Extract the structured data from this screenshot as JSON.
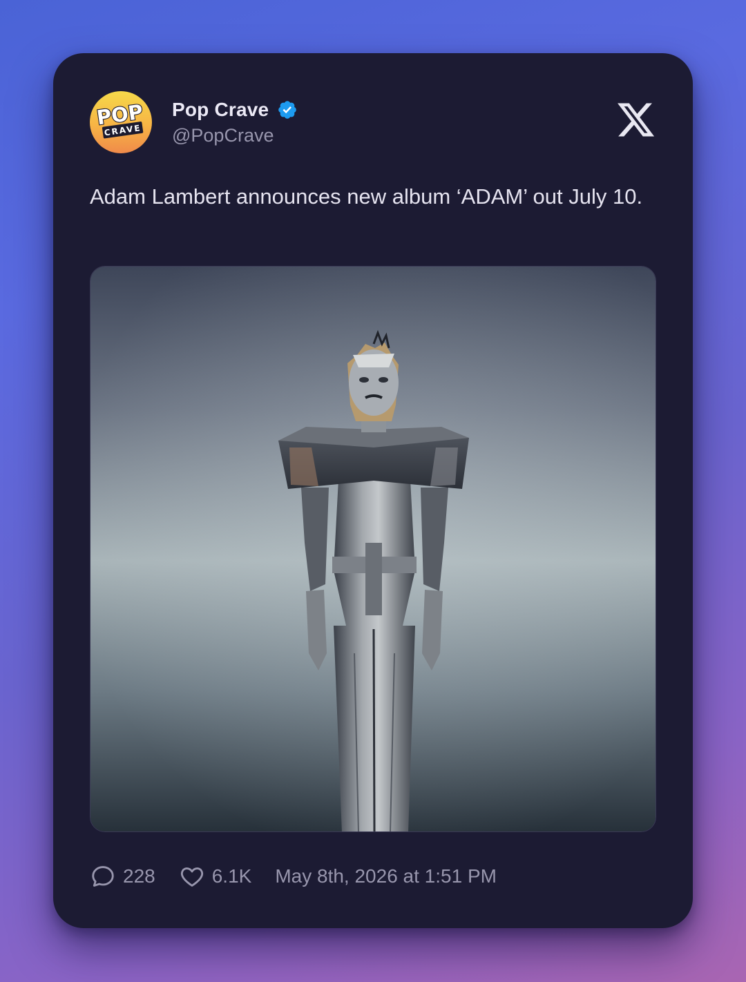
{
  "tweet": {
    "author_name": "Pop Crave",
    "author_handle": "@PopCrave",
    "verified": true,
    "avatar_text_top": "POP",
    "avatar_text_bottom": "CRAVE",
    "text": "Adam Lambert announces new album ‘ADAM’ out July 10.",
    "replies": "228",
    "likes": "6.1K",
    "timestamp": "May 8th, 2026 at 1:51 PM"
  },
  "icons": {
    "platform": "x-logo-icon",
    "reply": "speech-bubble-icon",
    "like": "heart-icon",
    "verified": "verified-badge-icon"
  },
  "colors": {
    "card_background": "#1c1b33",
    "verified_blue": "#1d9bf0",
    "primary_text": "#eceaf6",
    "secondary_text": "#9896ad"
  }
}
